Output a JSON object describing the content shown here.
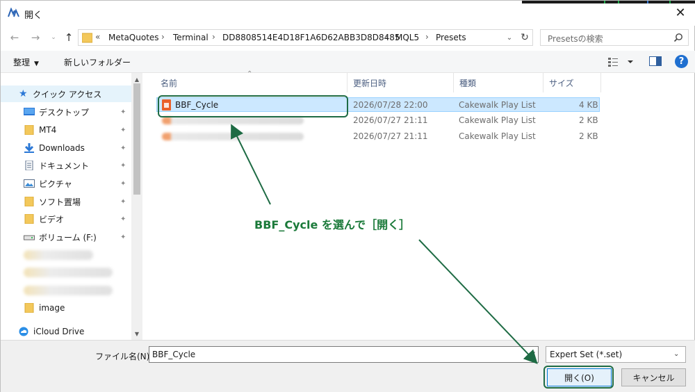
{
  "window": {
    "title": "開く"
  },
  "nav": {
    "path_prefix": "«",
    "crumbs": [
      "MetaQuotes",
      "Terminal",
      "DD8808514E4D18F1A6D62ABB3D8D8485",
      "MQL5",
      "Presets"
    ],
    "search_placeholder": "Presetsの検索"
  },
  "toolbar": {
    "organize_label": "整理",
    "new_folder_label": "新しいフォルダー",
    "help_label": "?"
  },
  "sidebar": {
    "items": [
      {
        "label": "クイック アクセス",
        "icon": "star-icon",
        "pinned": false
      },
      {
        "label": "デスクトップ",
        "icon": "desktop-icon",
        "pinned": true
      },
      {
        "label": "MT4",
        "icon": "folder-icon",
        "pinned": true
      },
      {
        "label": "Downloads",
        "icon": "download-icon",
        "pinned": true
      },
      {
        "label": "ドキュメント",
        "icon": "document-icon",
        "pinned": true
      },
      {
        "label": "ピクチャ",
        "icon": "picture-icon",
        "pinned": true
      },
      {
        "label": "ソフト置場",
        "icon": "folder-icon",
        "pinned": true
      },
      {
        "label": "ビデオ",
        "icon": "folder-icon",
        "pinned": true
      },
      {
        "label": "ボリューム (F:)",
        "icon": "drive-icon",
        "pinned": true
      },
      {
        "label": "image",
        "icon": "folder-icon",
        "pinned": false
      },
      {
        "label": "iCloud Drive",
        "icon": "cloud-icon",
        "pinned": false
      }
    ]
  },
  "columns": {
    "name": "名前",
    "modified": "更新日時",
    "type": "種類",
    "size": "サイズ"
  },
  "files": [
    {
      "name": "BBF_Cycle",
      "modified": "2026/07/28 22:00",
      "type": "Cakewalk Play List",
      "size": "4 KB",
      "selected": true
    },
    {
      "name": "",
      "modified": "2026/07/27 21:11",
      "type": "Cakewalk Play List",
      "size": "2 KB",
      "selected": false
    },
    {
      "name": "",
      "modified": "2026/07/27 21:11",
      "type": "Cakewalk Play List",
      "size": "2 KB",
      "selected": false
    }
  ],
  "bottom": {
    "filename_label": "ファイル名(N):",
    "filename_value": "BBF_Cycle",
    "filter_value": "Expert Set (*.set)",
    "open_label": "開く(O)",
    "cancel_label": "キャンセル"
  },
  "annotation": {
    "text": "BBF_Cycle を選んで［開く］",
    "color": "#1b7a3a"
  }
}
